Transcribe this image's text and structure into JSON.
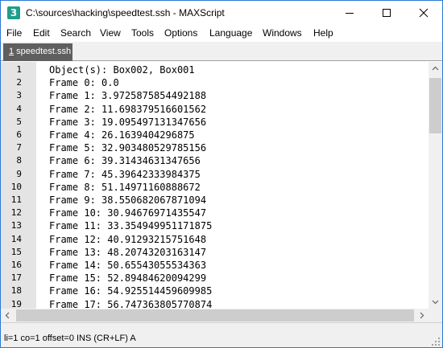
{
  "window": {
    "title": "C:\\sources\\hacking\\speedtest.ssh - MAXScript",
    "app_icon_glyph": "3"
  },
  "menu": [
    "File",
    "Edit",
    "Search",
    "View",
    "Tools",
    "Options",
    "Language",
    "Windows",
    "Help"
  ],
  "tab": {
    "index": "1",
    "name": " speedtest.ssh"
  },
  "editor": {
    "lines": [
      {
        "num": "1",
        "text": "Object(s): Box002, Box001"
      },
      {
        "num": "2",
        "text": "Frame 0: 0.0"
      },
      {
        "num": "3",
        "text": "Frame 1: 3.9725875854492188"
      },
      {
        "num": "4",
        "text": "Frame 2: 11.698379516601562"
      },
      {
        "num": "5",
        "text": "Frame 3: 19.095497131347656"
      },
      {
        "num": "6",
        "text": "Frame 4: 26.1639404296875"
      },
      {
        "num": "7",
        "text": "Frame 5: 32.903480529785156"
      },
      {
        "num": "8",
        "text": "Frame 6: 39.31434631347656"
      },
      {
        "num": "9",
        "text": "Frame 7: 45.39642333984375"
      },
      {
        "num": "10",
        "text": "Frame 8: 51.14971160888672"
      },
      {
        "num": "11",
        "text": "Frame 9: 38.550682067871094"
      },
      {
        "num": "12",
        "text": "Frame 10: 30.94676971435547"
      },
      {
        "num": "13",
        "text": "Frame 11: 33.354949951171875"
      },
      {
        "num": "14",
        "text": "Frame 12: 40.91293215751648"
      },
      {
        "num": "15",
        "text": "Frame 13: 48.20743203163147"
      },
      {
        "num": "16",
        "text": "Frame 14: 50.65543055534363"
      },
      {
        "num": "17",
        "text": "Frame 15: 52.89484620094299"
      },
      {
        "num": "18",
        "text": "Frame 16: 54.925514459609985"
      },
      {
        "num": "19",
        "text": "Frame 17: 56.747363805770874"
      }
    ]
  },
  "status": {
    "text": "li=1 co=1 offset=0 INS (CR+LF) A"
  },
  "colors": {
    "tab_bg": "#5f5f5f",
    "gutter_bg": "#e4e4e4",
    "app_icon_bg": "#1e9e8c",
    "window_border": "#2b79d4"
  }
}
